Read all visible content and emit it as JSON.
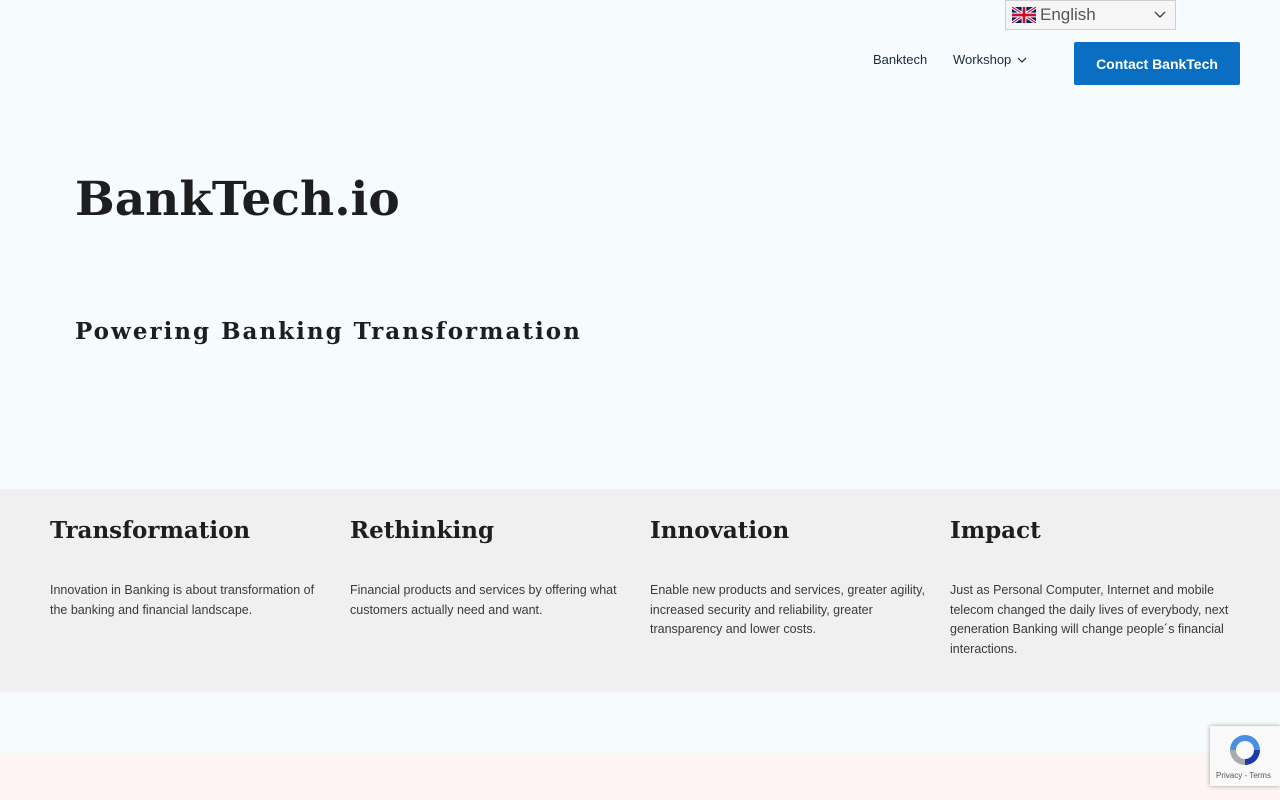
{
  "language": {
    "selected": "English",
    "flag_icon": "uk-flag-icon"
  },
  "nav": {
    "items": [
      {
        "label": "Banktech"
      },
      {
        "label": "Workshop",
        "has_dropdown": true
      }
    ],
    "cta_label": "Contact BankTech"
  },
  "hero": {
    "title": "BankTech.io",
    "subtitle": "Powering Banking Transformation"
  },
  "features": [
    {
      "title": "Transformation",
      "text": "Innovation in Banking is about transformation of the banking and financial landscape."
    },
    {
      "title": "Rethinking",
      "text": "Financial products and services by offering what customers actually need and want."
    },
    {
      "title": "Innovation",
      "text": "Enable new products and services, greater agility, increased security and reliability, greater transparency and lower costs."
    },
    {
      "title": "Impact",
      "text": "Just as Personal Computer, Internet and mobile telecom changed the daily lives of everybody, next generation Banking will change people´s financial interactions."
    }
  ],
  "recaptcha": {
    "terms": "Privacy - Terms"
  },
  "colors": {
    "accent": "#0a6fc2",
    "background": "#f6fbfe",
    "band": "#f0f0f0"
  }
}
